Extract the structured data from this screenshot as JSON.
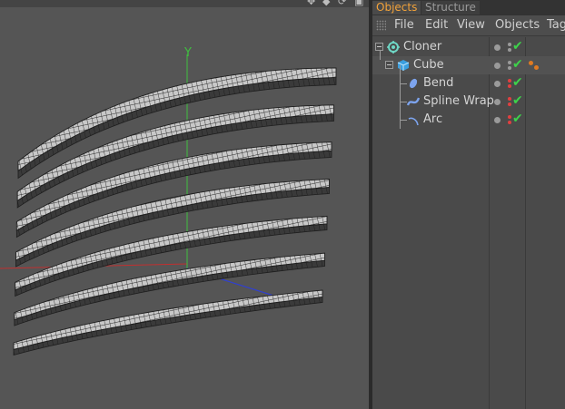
{
  "panel": {
    "tabs": [
      {
        "label": "Objects",
        "active": true
      },
      {
        "label": "Structure",
        "active": false
      }
    ],
    "menu": [
      "File",
      "Edit",
      "View",
      "Objects",
      "Tag"
    ]
  },
  "objects": [
    {
      "name": "Cloner",
      "icon": "cloner-icon",
      "enabled": true
    },
    {
      "name": "Cube",
      "icon": "cube-icon",
      "enabled": true,
      "tags": [
        "material-tag-icon"
      ]
    },
    {
      "name": "Bend",
      "icon": "bend-deformer-icon",
      "enabled": true
    },
    {
      "name": "Spline Wrap",
      "icon": "spline-wrap-icon",
      "enabled": true
    },
    {
      "name": "Arc",
      "icon": "arc-spline-icon",
      "enabled": true
    }
  ],
  "viewport": {
    "axis_label": "Y",
    "clone_count": 7
  },
  "colors": {
    "active_tab": "#f2a23a",
    "check": "#3dd34a",
    "axis_y": "#3fbf3f",
    "axis_x": "#c03030",
    "axis_z": "#3040d0",
    "viewport_bg": "#555555"
  }
}
